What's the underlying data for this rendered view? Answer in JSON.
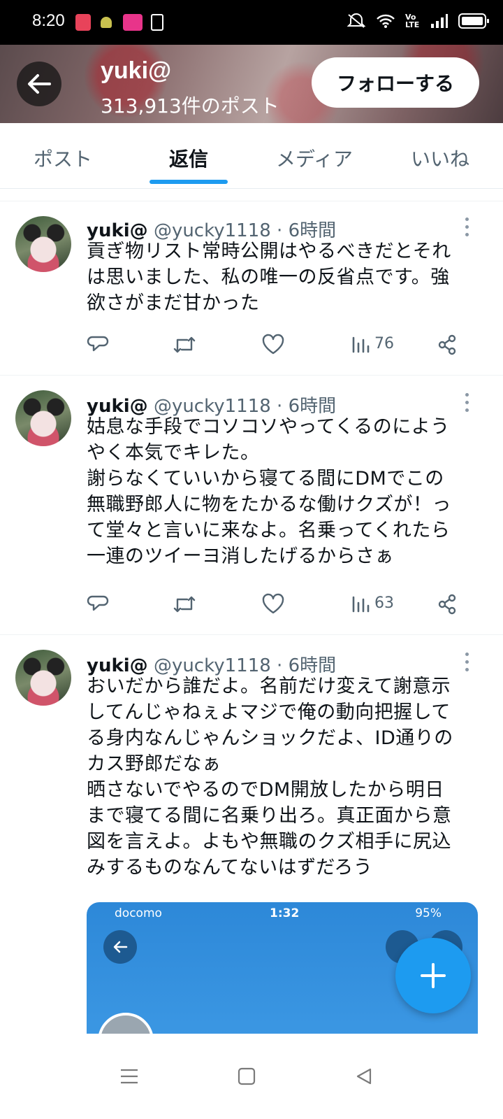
{
  "status_bar": {
    "time": "8:20",
    "icons": [
      "app-notification-icon",
      "android-icon",
      "app-notification-icon",
      "sim-icon",
      "mute-icon",
      "wifi-icon",
      "volte-icon",
      "signal-icon",
      "battery-icon"
    ],
    "volte_label": "Vo LTE"
  },
  "header": {
    "name": "yuki@",
    "post_count": "313,913件のポスト",
    "follow_label": "フォローする"
  },
  "tabs": [
    {
      "label": "ポスト",
      "active": false
    },
    {
      "label": "返信",
      "active": true
    },
    {
      "label": "メディア",
      "active": false
    },
    {
      "label": "いいね",
      "active": false
    }
  ],
  "tweets": [
    {
      "name": "yuki@",
      "meta": "@yucky1118 · 6時間",
      "text": "貢ぎ物リスト常時公開はやるべきだとそれ\nは思いました、私の唯一の反省点です。強\n欲さがまだ甘かった",
      "views": "76"
    },
    {
      "name": "yuki@",
      "meta": "@yucky1118 · 6時間",
      "text": "姑息な手段でコソコソやってくるのによう\nやく本気でキレた。\n謝らなくていいから寝てる間にDMでこの\n無職野郎人に物をたかるな働けクズが！っ\nて堂々と言いに来なよ。名乗ってくれたら\n一連のツイーヨ消したげるからさぁ",
      "views": "63"
    },
    {
      "name": "yuki@",
      "meta": "@yucky1118 · 6時間",
      "text": "おいだから誰だよ。名前だけ変えて謝意示\nしてんじゃねぇよマジで俺の動向把握して\nる身内なんじゃんショックだよ、ID通りの\nカス野郎だなぁ\n晒さないでやるのでDM開放したから明日\nまで寝てる間に名乗り出ろ。真正面から意\n図を言えよ。よもや無職のクズ相手に尻込\nみするものなんてないはずだろう"
    }
  ],
  "embedded_image": {
    "carrier": "docomo",
    "time": "1:32",
    "battery": "95%"
  },
  "colors": {
    "accent": "#1d9bf0",
    "text": "#0f1419",
    "muted": "#536471"
  }
}
